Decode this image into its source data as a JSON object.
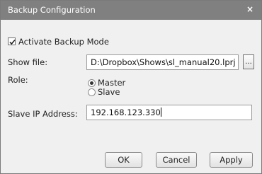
{
  "window": {
    "title": "Backup Configuration",
    "close_label": "×"
  },
  "activate": {
    "label": "Activate Backup Mode",
    "checked": true
  },
  "show_file": {
    "label": "Show file:",
    "value": "D:\\Dropbox\\Shows\\sl_manual20.lprj",
    "browse_label": "..."
  },
  "role": {
    "label": "Role:",
    "options": [
      "Master",
      "Slave"
    ],
    "selected": "Master"
  },
  "slave_ip": {
    "label": "Slave IP Address:",
    "value": "192.168.123.330"
  },
  "buttons": {
    "ok": "OK",
    "cancel": "Cancel",
    "apply": "Apply"
  }
}
